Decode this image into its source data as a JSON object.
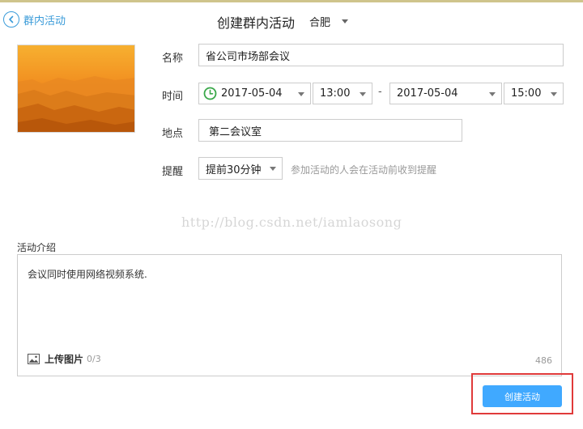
{
  "header": {
    "back_label": "群内活动",
    "title": "创建群内活动",
    "city": "合肥"
  },
  "form": {
    "name": {
      "label": "名称",
      "value": "省公司市场部会议"
    },
    "time": {
      "label": "时间",
      "start_date": "2017-05-04",
      "start_time": "13:00",
      "separator": "-",
      "end_date": "2017-05-04",
      "end_time": "15:00"
    },
    "location": {
      "label": "地点",
      "value": "第二会议室"
    },
    "reminder": {
      "label": "提醒",
      "value": "提前30分钟",
      "hint": "参加活动的人会在活动前收到提醒"
    }
  },
  "watermark": "http://blog.csdn.net/iamlaosong",
  "description": {
    "label": "活动介绍",
    "text": "会议同时使用网络视频系统.",
    "upload_label": "上传图片",
    "upload_count": "0/3",
    "char_remaining": "486"
  },
  "actions": {
    "create_label": "创建活动"
  },
  "colors": {
    "accent": "#40a9ff",
    "link": "#3a9bd9",
    "highlight_frame": "#e03a3a",
    "clock": "#3aa84a"
  },
  "icons": [
    "back-arrow-icon",
    "clock-icon",
    "image-icon",
    "chevron-down-icon"
  ]
}
